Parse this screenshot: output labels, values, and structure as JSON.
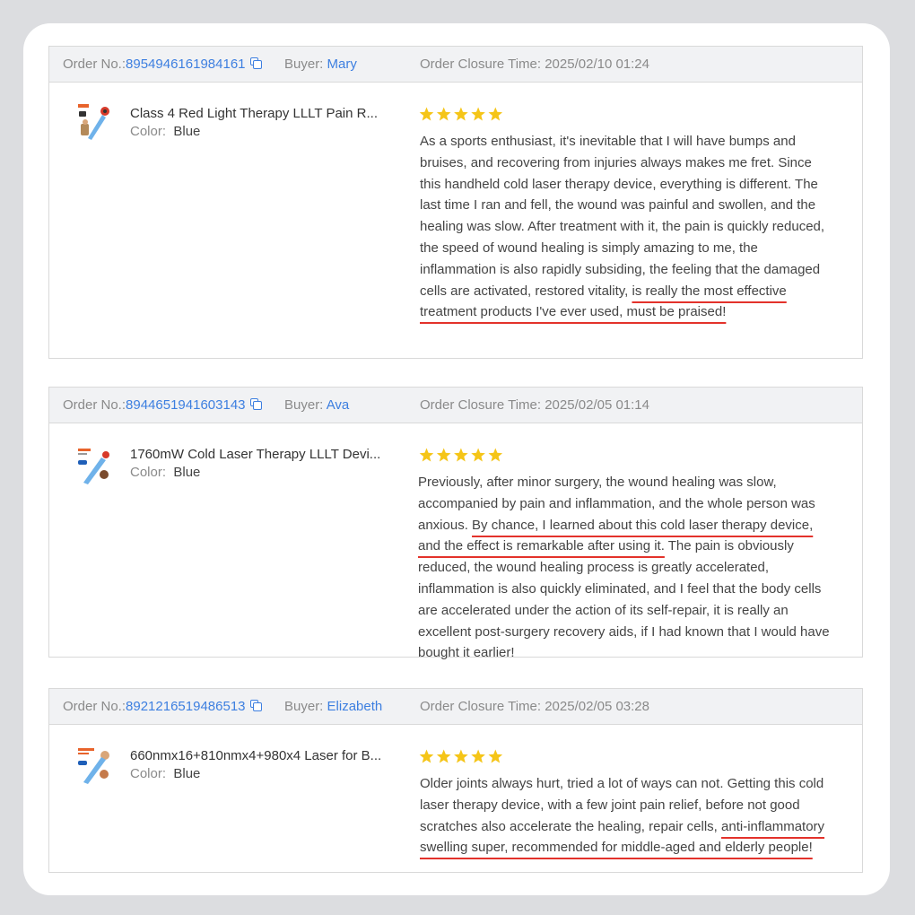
{
  "labels": {
    "order": "Order No.:",
    "buyer": "Buyer:",
    "color": "Color:",
    "closure": "Order Closure Time:"
  },
  "colors": {
    "link_blue": "#3d7fe0",
    "star_gold": "#f5c518",
    "underline_red": "#e3322b",
    "header_bg": "#f1f2f4"
  },
  "orders": [
    {
      "order_no": "8954946161984161",
      "buyer": "Mary",
      "closure_time": "2025/02/10 01:24",
      "product_name": "Class 4 Red Light Therapy LLLT Pain R...",
      "color": "Blue",
      "rating": 5,
      "review_plain": "As a sports enthusiast, it's inevitable that I will have bumps and bruises, and recovering from injuries always makes me fret. Since this handheld cold laser therapy device, everything is different. The last time I ran and fell, the wound was painful and swollen, and the healing was slow. After treatment with it, the pain is quickly reduced, the speed of wound healing is simply amazing to me, the inflammation is also rapidly subsiding, the feeling that the damaged cells are activated, restored vitality, ",
      "review_highlight": "is really the most effective treatment products I've ever used, must be praised!",
      "review_after": ""
    },
    {
      "order_no": "8944651941603143",
      "buyer": "Ava",
      "closure_time": "2025/02/05 01:14",
      "product_name": "1760mW Cold Laser Therapy LLLT Devi...",
      "color": "Blue",
      "rating": 5,
      "review_plain": "Previously, after minor surgery, the wound healing was slow, accompanied by pain and inflammation, and the whole person was anxious. ",
      "review_highlight": "By chance, I learned about this cold laser therapy device, and the effect is remarkable after using it.",
      "review_after": " The pain is obviously reduced, the wound healing process is greatly accelerated, inflammation is also quickly eliminated, and I feel that the body cells are accelerated under the action of its self-repair, it is really an excellent post-surgery recovery aids, if I had known that I would have bought it earlier!"
    },
    {
      "order_no": "8921216519486513",
      "buyer": "Elizabeth",
      "closure_time": "2025/02/05 03:28",
      "product_name": "660nmx16+810nmx4+980x4 Laser for B...",
      "color": "Blue",
      "rating": 5,
      "review_plain": "Older joints always hurt, tried a lot of ways can not. Getting this cold laser therapy device, with a few joint pain relief, before not good scratches also accelerate the healing, repair cells, ",
      "review_highlight": "anti-inflammatory swelling super, recommended for middle-aged and elderly people!",
      "review_after": ""
    }
  ]
}
